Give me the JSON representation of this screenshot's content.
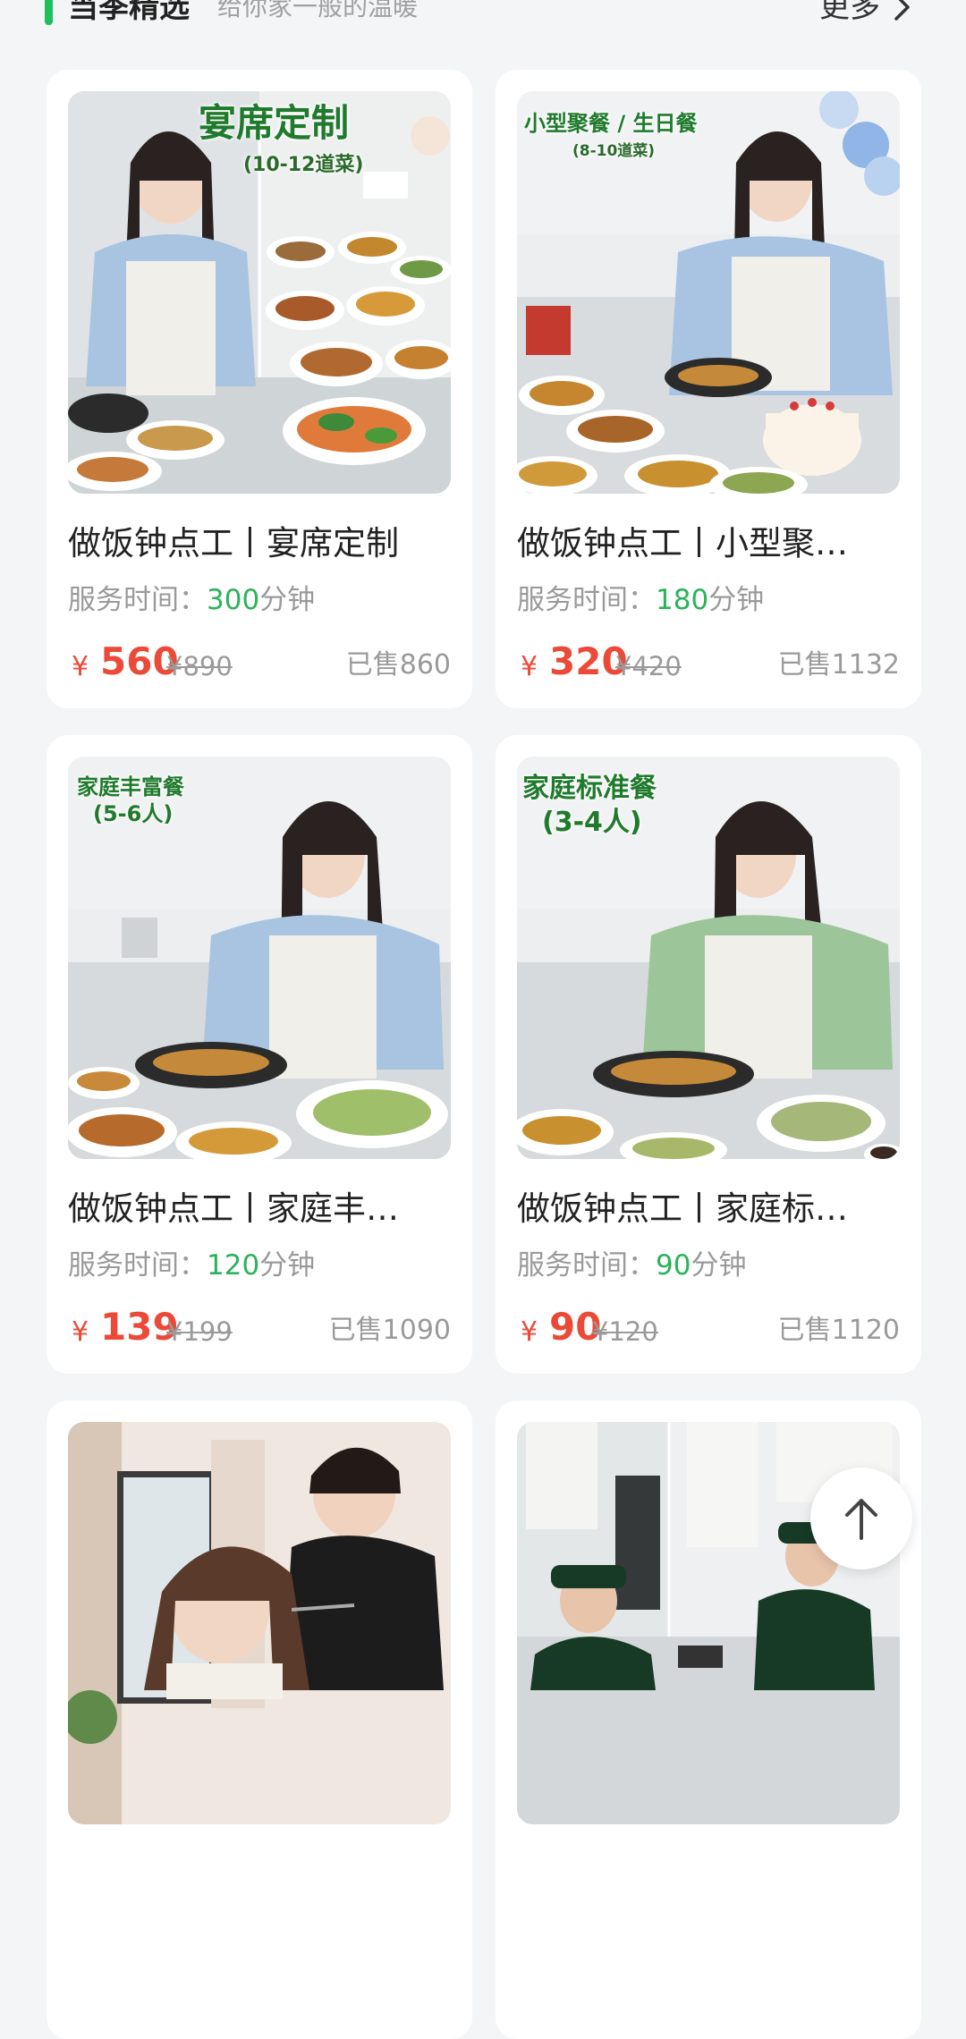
{
  "header": {
    "title": "当季精选",
    "subtitle": "给你家一般的温暖",
    "more_label": "更多"
  },
  "cards": [
    {
      "overlay_title": "宴席定制",
      "overlay_sub": "(10-12道菜)",
      "name": "做饭钟点工丨宴席定制",
      "time_label": "服务时间：",
      "time_value": "300",
      "time_unit": "分钟",
      "currency": "¥",
      "price": "560",
      "original_price": "¥890",
      "sold": "已售860"
    },
    {
      "overlay_title": "小型聚餐 / 生日餐",
      "overlay_sub": "(8-10道菜)",
      "name": "做饭钟点工丨小型聚…",
      "time_label": "服务时间：",
      "time_value": "180",
      "time_unit": "分钟",
      "currency": "¥",
      "price": "320",
      "original_price": "¥420",
      "sold": "已售1132"
    },
    {
      "overlay_title": "家庭丰富餐",
      "overlay_sub": "(5-6人)",
      "name": "做饭钟点工丨家庭丰…",
      "time_label": "服务时间：",
      "time_value": "120",
      "time_unit": "分钟",
      "currency": "¥",
      "price": "139",
      "original_price": "¥199",
      "sold": "已售1090"
    },
    {
      "overlay_title": "家庭标准餐",
      "overlay_sub": "(3-4人)",
      "name": "做饭钟点工丨家庭标…",
      "time_label": "服务时间：",
      "time_value": "90",
      "time_unit": "分钟",
      "currency": "¥",
      "price": "90",
      "original_price": "¥120",
      "sold": "已售1120"
    }
  ],
  "back_to_top_icon": "arrow-up-icon",
  "colors": {
    "accent_green": "#1fbf5a",
    "price_red": "#ec4a38"
  }
}
